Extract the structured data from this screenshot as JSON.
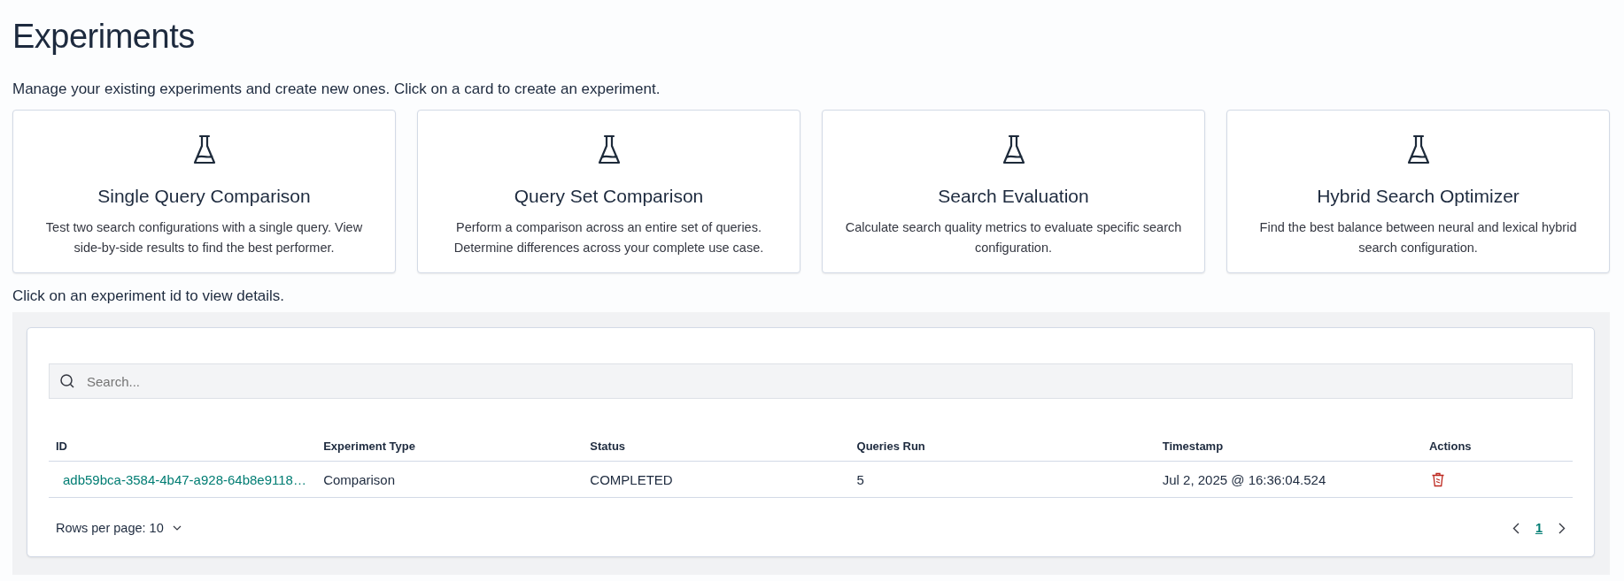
{
  "title": "Experiments",
  "description": "Manage your existing experiments and create new ones. Click on a card to create an experiment.",
  "cards": [
    {
      "title": "Single Query Comparison",
      "text": "Test two search configurations with a single query. View side-by-side results to find the best performer."
    },
    {
      "title": "Query Set Comparison",
      "text": "Perform a comparison across an entire set of queries. Determine differences across your complete use case."
    },
    {
      "title": "Search Evaluation",
      "text": "Calculate search quality metrics to evaluate specific search configuration."
    },
    {
      "title": "Hybrid Search Optimizer",
      "text": "Find the best balance between neural and lexical hybrid search configuration."
    }
  ],
  "table_hint": "Click on an experiment id to view details.",
  "search": {
    "placeholder": "Search..."
  },
  "table": {
    "columns": [
      "ID",
      "Experiment Type",
      "Status",
      "Queries Run",
      "Timestamp",
      "Actions"
    ],
    "rows": [
      {
        "id": "adb59bca-3584-4b47-a928-64b8e9118…",
        "type": "Comparison",
        "status": "COMPLETED",
        "queries_run": "5",
        "timestamp": "Jul 2, 2025 @ 16:36:04.524"
      }
    ]
  },
  "pagination": {
    "rows_per_page": "Rows per page: 10",
    "pages": [
      {
        "label": "1",
        "selected": true
      }
    ]
  }
}
